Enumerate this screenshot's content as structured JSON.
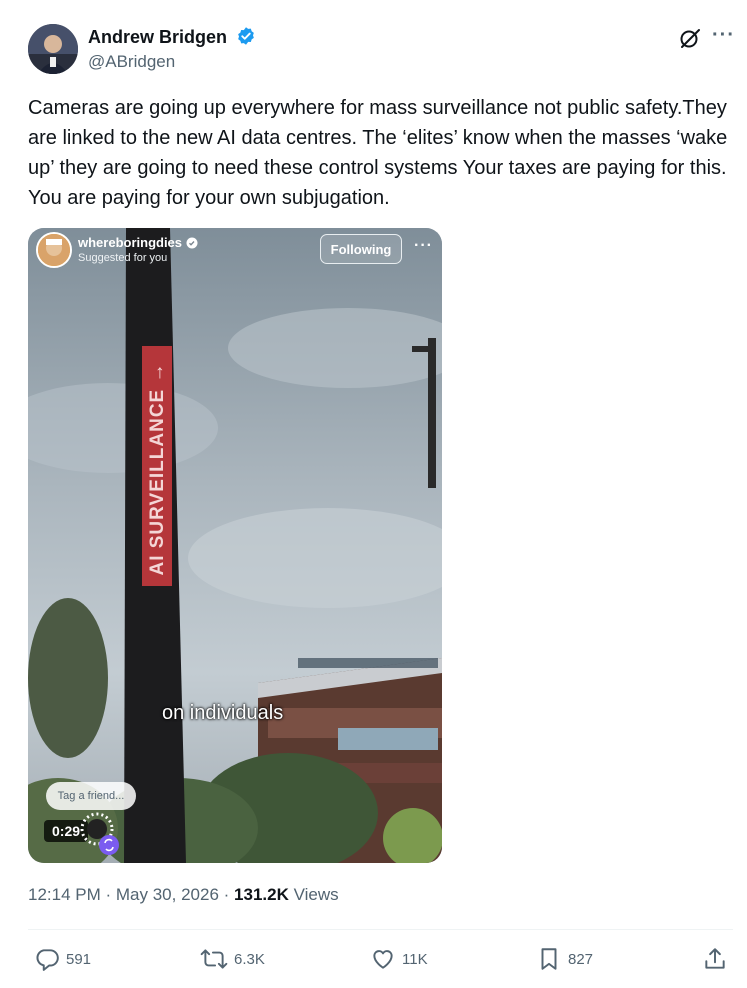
{
  "post": {
    "author_name": "Andrew Bridgen",
    "author_handle": "@ABridgen",
    "text": "Cameras are going up everywhere for mass surveillance not public safety.They are linked to the new AI data centres. The ‘elites’ know when the masses ‘wake up’ they are going to need these control systems Your taxes are paying for this. You are paying for your own subjugation.",
    "time": "12:14 PM",
    "date": "May 30, 2026",
    "views_count": "131.2K",
    "views_label": "Views"
  },
  "video": {
    "account": "whereboringdies",
    "suggested": "Suggested for you",
    "follow_label": "Following",
    "pole_text": "AI SURVEILLANCE →",
    "caption": "on individuals",
    "tag_friend": "Tag a friend...",
    "duration": "0:29"
  },
  "actions": {
    "replies": "591",
    "reposts": "6.3K",
    "likes": "11K",
    "bookmarks": "827"
  },
  "colors": {
    "verified": "#1d9bf0",
    "secondary_text": "#536471"
  }
}
